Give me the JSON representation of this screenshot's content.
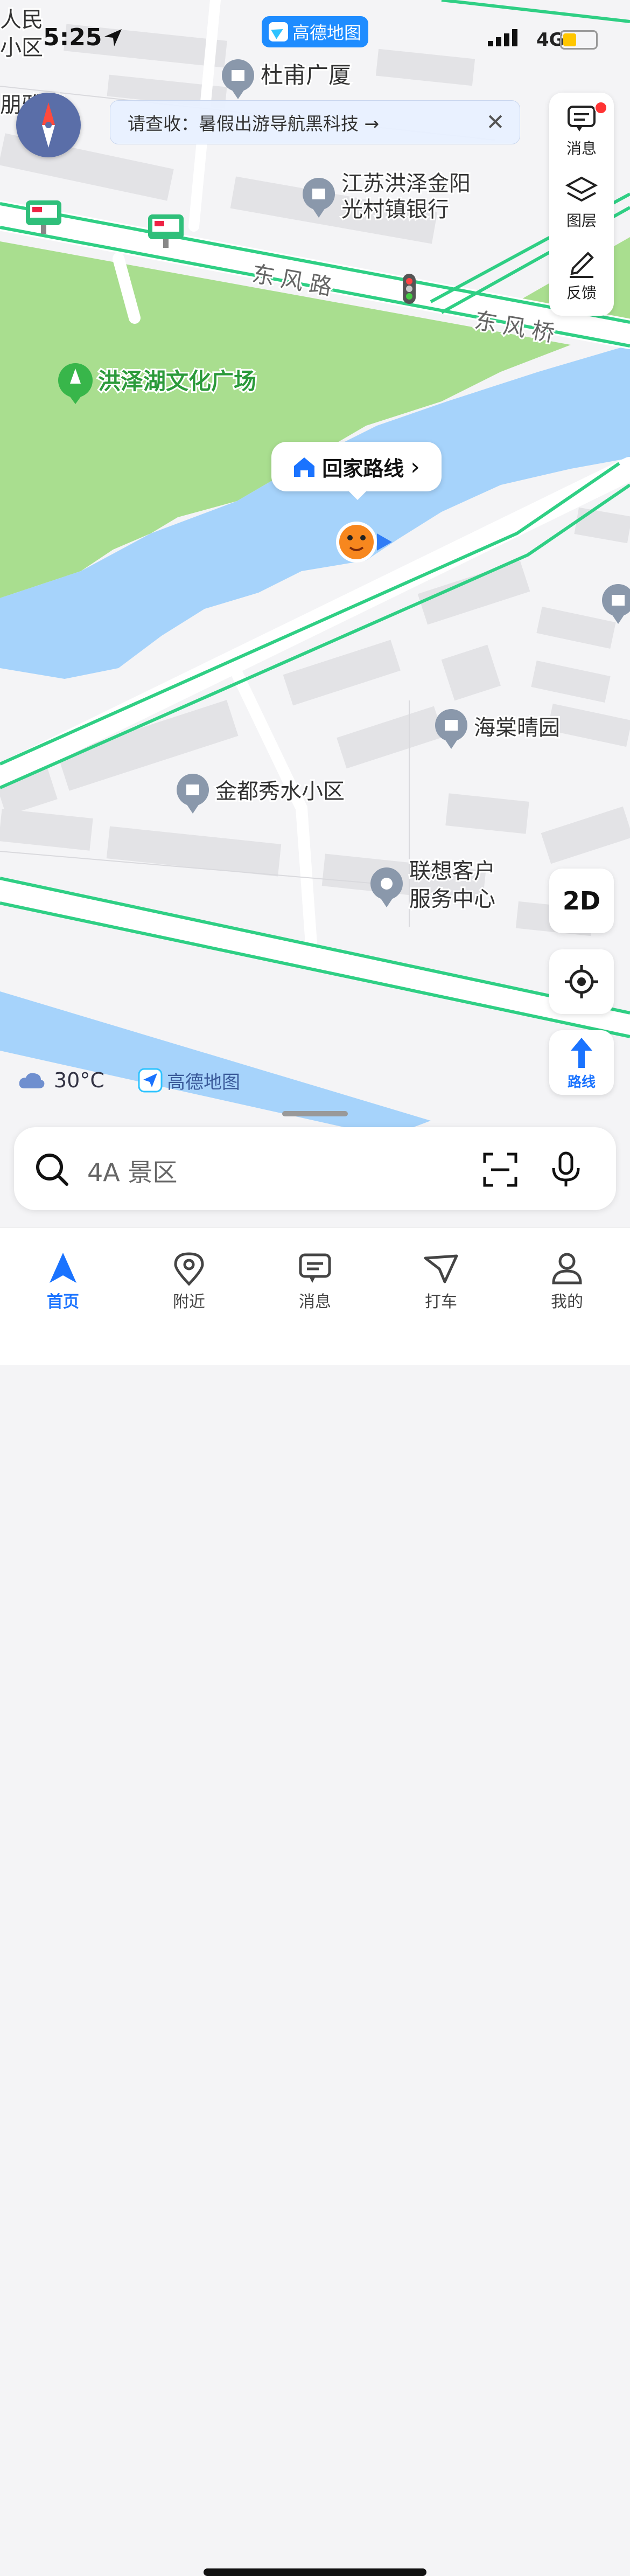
{
  "status_bar": {
    "time": "5:25",
    "network": "4G",
    "app_pill": "高德地图"
  },
  "notice": {
    "text": "请查收：暑假出游导航黑科技 →",
    "close_label": "✕"
  },
  "side_panel": {
    "messages": "消息",
    "layers": "图层",
    "feedback": "反馈"
  },
  "map": {
    "labels": {
      "top_left_1": "人民",
      "top_left_2": "小区",
      "top_left_3": "朋雅苑",
      "dupu": "杜甫广厦",
      "bank_1": "江苏洪泽金阳",
      "bank_2": "光村镇银行",
      "road_dongfeng": "东风路",
      "bridge_dongfeng": "东风桥",
      "park": "洪泽湖文化广场",
      "haitang": "海棠晴园",
      "jindu": "金都秀水小区",
      "lenovo_1": "联想客户",
      "lenovo_2": "服务中心"
    },
    "colors": {
      "green_area": "#a9de8f",
      "water": "#a6d3fb",
      "road_line": "#2fcf84",
      "land": "#f4f4f6",
      "building": "#e3e3e6"
    }
  },
  "home_bubble": {
    "label": "回家路线",
    "arrow": "›"
  },
  "controls": {
    "mode_2d": "2D",
    "route_label": "路线"
  },
  "weather": {
    "temperature": "30°C",
    "brand": "高德地图"
  },
  "search": {
    "placeholder": "4A 景区"
  },
  "tabs": [
    {
      "label": "首页",
      "active": true
    },
    {
      "label": "附近",
      "active": false
    },
    {
      "label": "消息",
      "active": false
    },
    {
      "label": "打车",
      "active": false
    },
    {
      "label": "我的",
      "active": false
    }
  ]
}
